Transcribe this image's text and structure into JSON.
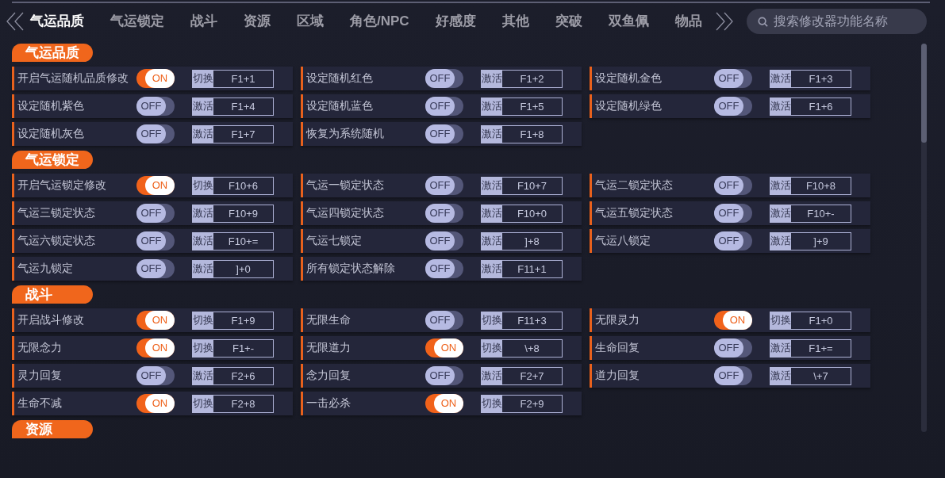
{
  "tab_bar": {
    "tabs": [
      {
        "label": "气运品质",
        "selected": true
      },
      {
        "label": "气运锁定",
        "selected": false
      },
      {
        "label": "战斗",
        "selected": false
      },
      {
        "label": "资源",
        "selected": false
      },
      {
        "label": "区域",
        "selected": false
      },
      {
        "label": "角色/NPC",
        "selected": false
      },
      {
        "label": "好感度",
        "selected": false
      },
      {
        "label": "其他",
        "selected": false
      },
      {
        "label": "突破",
        "selected": false
      },
      {
        "label": "双鱼佩",
        "selected": false
      },
      {
        "label": "物品",
        "selected": false
      }
    ],
    "search": {
      "placeholder": "搜索修改器功能名称"
    }
  },
  "sections": [
    {
      "title": "气运品质",
      "options": [
        {
          "label": "开启气运随机品质修改",
          "on": true,
          "switch_text": "ON",
          "action": "切换",
          "hotkey": "F1+1"
        },
        {
          "label": "设定随机红色",
          "on": false,
          "switch_text": "OFF",
          "action": "激活",
          "hotkey": "F1+2"
        },
        {
          "label": "设定随机金色",
          "on": false,
          "switch_text": "OFF",
          "action": "激活",
          "hotkey": "F1+3"
        },
        {
          "label": "设定随机紫色",
          "on": false,
          "switch_text": "OFF",
          "action": "激活",
          "hotkey": "F1+4"
        },
        {
          "label": "设定随机蓝色",
          "on": false,
          "switch_text": "OFF",
          "action": "激活",
          "hotkey": "F1+5"
        },
        {
          "label": "设定随机绿色",
          "on": false,
          "switch_text": "OFF",
          "action": "激活",
          "hotkey": "F1+6"
        },
        {
          "label": "设定随机灰色",
          "on": false,
          "switch_text": "OFF",
          "action": "激活",
          "hotkey": "F1+7"
        },
        {
          "label": "恢复为系统随机",
          "on": false,
          "switch_text": "OFF",
          "action": "激活",
          "hotkey": "F1+8"
        }
      ]
    },
    {
      "title": "气运锁定",
      "options": [
        {
          "label": "开启气运锁定修改",
          "on": true,
          "switch_text": "ON",
          "action": "切换",
          "hotkey": "F10+6"
        },
        {
          "label": "气运一锁定状态",
          "on": false,
          "switch_text": "OFF",
          "action": "激活",
          "hotkey": "F10+7"
        },
        {
          "label": "气运二锁定状态",
          "on": false,
          "switch_text": "OFF",
          "action": "激活",
          "hotkey": "F10+8"
        },
        {
          "label": "气运三锁定状态",
          "on": false,
          "switch_text": "OFF",
          "action": "激活",
          "hotkey": "F10+9"
        },
        {
          "label": "气运四锁定状态",
          "on": false,
          "switch_text": "OFF",
          "action": "激活",
          "hotkey": "F10+0"
        },
        {
          "label": "气运五锁定状态",
          "on": false,
          "switch_text": "OFF",
          "action": "激活",
          "hotkey": "F10+-"
        },
        {
          "label": "气运六锁定状态",
          "on": false,
          "switch_text": "OFF",
          "action": "激活",
          "hotkey": "F10+="
        },
        {
          "label": "气运七锁定",
          "on": false,
          "switch_text": "OFF",
          "action": "激活",
          "hotkey": "]+8"
        },
        {
          "label": "气运八锁定",
          "on": false,
          "switch_text": "OFF",
          "action": "激活",
          "hotkey": "]+9"
        },
        {
          "label": "气运九锁定",
          "on": false,
          "switch_text": "OFF",
          "action": "激活",
          "hotkey": "]+0"
        },
        {
          "label": "所有锁定状态解除",
          "on": false,
          "switch_text": "OFF",
          "action": "激活",
          "hotkey": "F11+1"
        }
      ]
    },
    {
      "title": "战斗",
      "options": [
        {
          "label": "开启战斗修改",
          "on": true,
          "switch_text": "ON",
          "action": "切换",
          "hotkey": "F1+9"
        },
        {
          "label": "无限生命",
          "on": false,
          "switch_text": "OFF",
          "action": "切换",
          "hotkey": "F11+3"
        },
        {
          "label": "无限灵力",
          "on": true,
          "switch_text": "ON",
          "action": "切换",
          "hotkey": "F1+0"
        },
        {
          "label": "无限念力",
          "on": true,
          "switch_text": "ON",
          "action": "切换",
          "hotkey": "F1+-"
        },
        {
          "label": "无限道力",
          "on": true,
          "switch_text": "ON",
          "action": "切换",
          "hotkey": "\\+8"
        },
        {
          "label": "生命回复",
          "on": false,
          "switch_text": "OFF",
          "action": "激活",
          "hotkey": "F1+="
        },
        {
          "label": "灵力回复",
          "on": false,
          "switch_text": "OFF",
          "action": "激活",
          "hotkey": "F2+6"
        },
        {
          "label": "念力回复",
          "on": false,
          "switch_text": "OFF",
          "action": "激活",
          "hotkey": "F2+7"
        },
        {
          "label": "道力回复",
          "on": false,
          "switch_text": "OFF",
          "action": "激活",
          "hotkey": "\\+7"
        },
        {
          "label": "生命不减",
          "on": true,
          "switch_text": "ON",
          "action": "切换",
          "hotkey": "F2+8"
        },
        {
          "label": "一击必杀",
          "on": true,
          "switch_text": "ON",
          "action": "切换",
          "hotkey": "F2+9"
        }
      ]
    },
    {
      "title": "资源"
    }
  ]
}
